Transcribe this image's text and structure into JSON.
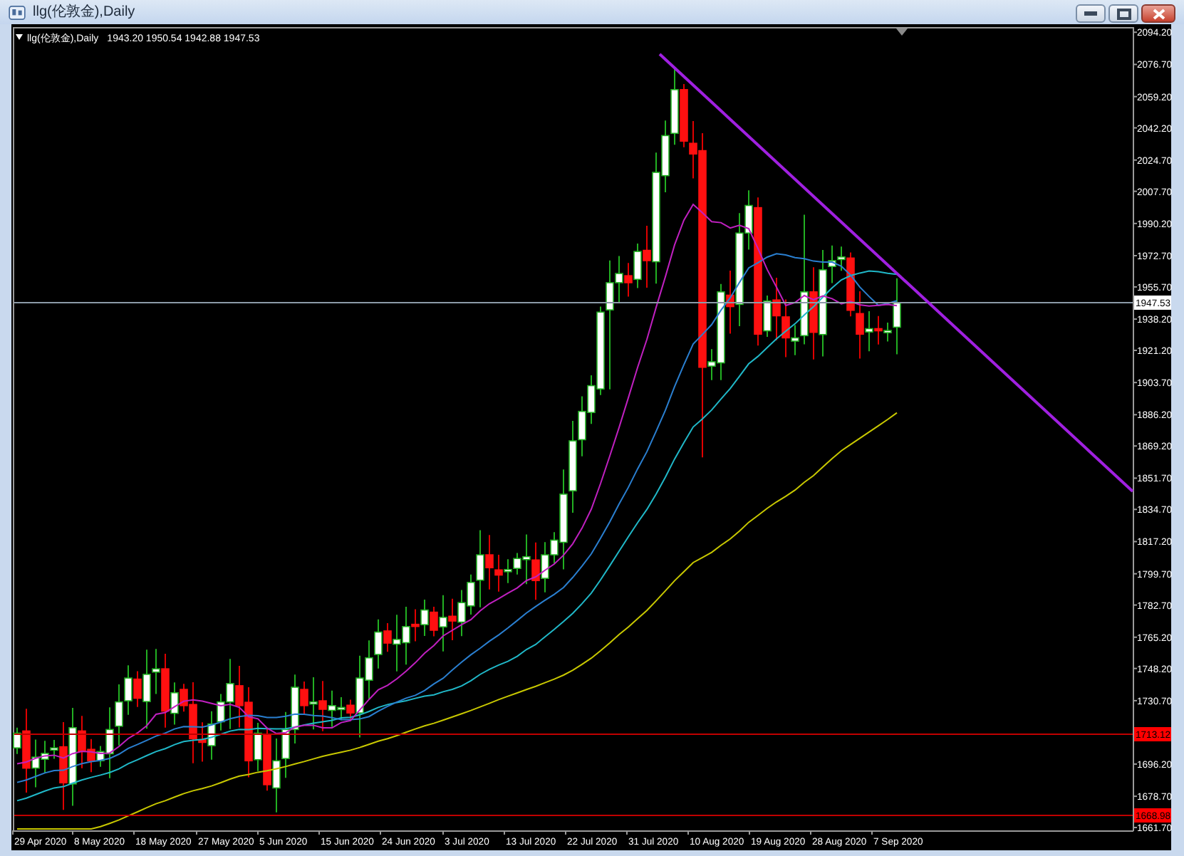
{
  "window": {
    "title": "llg(伦敦金),Daily"
  },
  "chart": {
    "legend": {
      "symbol": "llg(伦敦金),Daily",
      "ohlc": "1943.20 1950.54 1942.88 1947.53"
    },
    "price_axis": [
      "2094.20",
      "2076.70",
      "2059.20",
      "2042.20",
      "2024.70",
      "2007.70",
      "1990.20",
      "1972.70",
      "1955.70",
      "1938.20",
      "1921.20",
      "1903.70",
      "1886.20",
      "1869.20",
      "1851.70",
      "1834.70",
      "1817.20",
      "1799.70",
      "1782.70",
      "1765.20",
      "1748.20",
      "1730.70",
      "1696.20",
      "1678.70",
      "1661.70"
    ],
    "price_markers": [
      {
        "label": "1947.53",
        "kind": "bid"
      },
      {
        "label": "1713.12",
        "kind": "level"
      },
      {
        "label": "1668.98",
        "kind": "level"
      }
    ],
    "date_axis": [
      "29 Apr 2020",
      "8 May 2020",
      "18 May 2020",
      "27 May 2020",
      "5 Jun 2020",
      "15 Jun 2020",
      "24 Jun 2020",
      "3 Jul 2020",
      "13 Jul 2020",
      "22 Jul 2020",
      "31 Jul 2020",
      "10 Aug 2020",
      "19 Aug 2020",
      "28 Aug 2020",
      "7 Sep 2020"
    ]
  }
}
